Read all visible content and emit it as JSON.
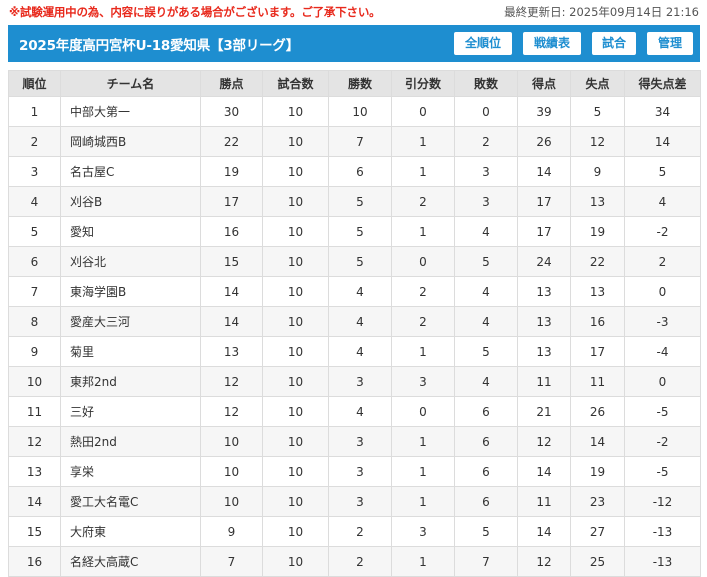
{
  "notice": "※試験運用中の為、内容に誤りがある場合がございます。ご了承下さい。",
  "last_updated": "最終更新日: 2025年09月14日 21:16",
  "header": {
    "title": "2025年度高円宮杯U-18愛知県【3部リーグ】",
    "buttons": [
      "全順位",
      "戦績表",
      "試合",
      "管理"
    ]
  },
  "table": {
    "columns": [
      "順位",
      "チーム名",
      "勝点",
      "試合数",
      "勝数",
      "引分数",
      "敗数",
      "得点",
      "失点",
      "得失点差"
    ],
    "rows": [
      [
        "1",
        "中部大第一",
        "30",
        "10",
        "10",
        "0",
        "0",
        "39",
        "5",
        "34"
      ],
      [
        "2",
        "岡崎城西B",
        "22",
        "10",
        "7",
        "1",
        "2",
        "26",
        "12",
        "14"
      ],
      [
        "3",
        "名古屋C",
        "19",
        "10",
        "6",
        "1",
        "3",
        "14",
        "9",
        "5"
      ],
      [
        "4",
        "刈谷B",
        "17",
        "10",
        "5",
        "2",
        "3",
        "17",
        "13",
        "4"
      ],
      [
        "5",
        "愛知",
        "16",
        "10",
        "5",
        "1",
        "4",
        "17",
        "19",
        "-2"
      ],
      [
        "6",
        "刈谷北",
        "15",
        "10",
        "5",
        "0",
        "5",
        "24",
        "22",
        "2"
      ],
      [
        "7",
        "東海学園B",
        "14",
        "10",
        "4",
        "2",
        "4",
        "13",
        "13",
        "0"
      ],
      [
        "8",
        "愛産大三河",
        "14",
        "10",
        "4",
        "2",
        "4",
        "13",
        "16",
        "-3"
      ],
      [
        "9",
        "菊里",
        "13",
        "10",
        "4",
        "1",
        "5",
        "13",
        "17",
        "-4"
      ],
      [
        "10",
        "東邦2nd",
        "12",
        "10",
        "3",
        "3",
        "4",
        "11",
        "11",
        "0"
      ],
      [
        "11",
        "三好",
        "12",
        "10",
        "4",
        "0",
        "6",
        "21",
        "26",
        "-5"
      ],
      [
        "12",
        "熱田2nd",
        "10",
        "10",
        "3",
        "1",
        "6",
        "12",
        "14",
        "-2"
      ],
      [
        "13",
        "享栄",
        "10",
        "10",
        "3",
        "1",
        "6",
        "14",
        "19",
        "-5"
      ],
      [
        "14",
        "愛工大名電C",
        "10",
        "10",
        "3",
        "1",
        "6",
        "11",
        "23",
        "-12"
      ],
      [
        "15",
        "大府東",
        "9",
        "10",
        "2",
        "3",
        "5",
        "14",
        "27",
        "-13"
      ],
      [
        "16",
        "名経大高蔵C",
        "7",
        "10",
        "2",
        "1",
        "7",
        "12",
        "25",
        "-13"
      ]
    ]
  }
}
